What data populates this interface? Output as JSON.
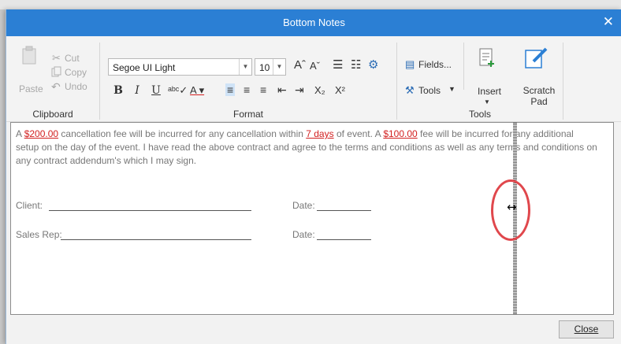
{
  "window": {
    "title": "Bottom Notes",
    "close_glyph": "✕"
  },
  "ribbon": {
    "clipboard": {
      "label": "Clipboard",
      "paste": "Paste",
      "cut": "Cut",
      "copy": "Copy",
      "undo": "Undo"
    },
    "format": {
      "label": "Format",
      "font_name": "Segoe UI Light",
      "font_size": "10",
      "bold": "B",
      "italic": "I",
      "underline": "U",
      "subscript": "X₂",
      "superscript": "X²"
    },
    "tools": {
      "label": "Tools",
      "fields": "Fields...",
      "tools": "Tools",
      "insert": "Insert",
      "scratch_pad": "Scratch Pad"
    }
  },
  "document": {
    "text_1": "A ",
    "link_1": "$200.00",
    "text_2": " cancellation fee will be incurred for any cancellation within ",
    "link_2": "7 days",
    "text_3": " of event. A ",
    "link_3": "$100.00",
    "text_4": " fee will be incurred for any additional setup on the day of the event. I have read the above contract and agree to the terms and conditions as well as any terms and conditions on any contract addendum's which I may sign.",
    "client_label": "Client:",
    "date_label_1": "Date:",
    "sales_rep_label": "Sales Rep:",
    "date_label_2": "Date:"
  },
  "footer": {
    "close": "Close"
  },
  "colors": {
    "titlebar": "#2b7fd4",
    "link_red": "#d21f1f",
    "ring": "#e0474c"
  }
}
